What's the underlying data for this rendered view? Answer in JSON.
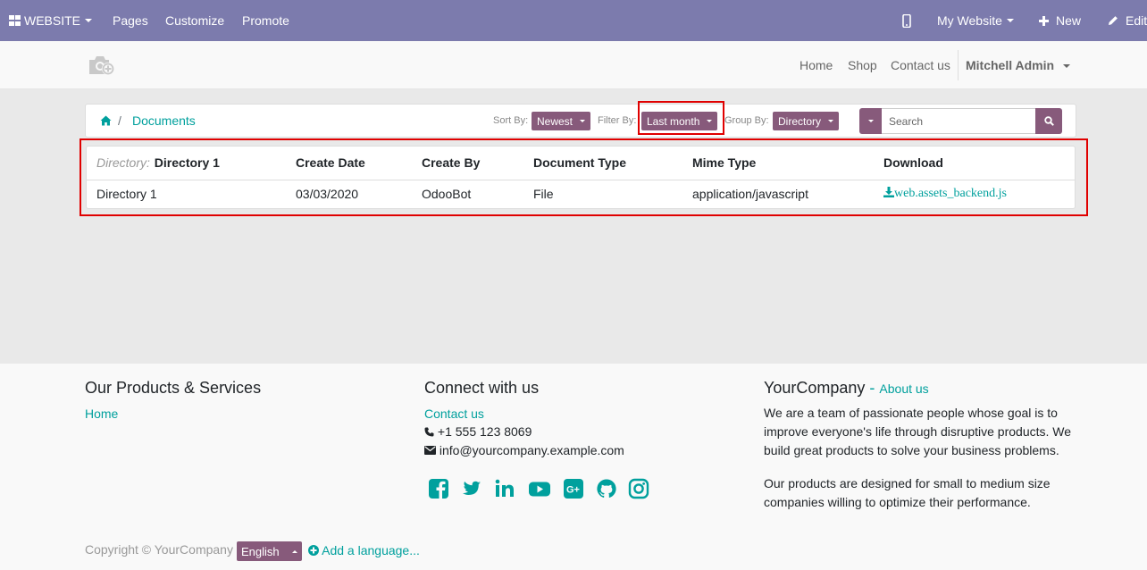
{
  "topbar": {
    "apps_label": "WEBSITE",
    "menu": [
      "Pages",
      "Customize",
      "Promote"
    ],
    "mobile_icon": "mobile-icon",
    "website_label": "My Website",
    "new_label": "New",
    "edit_label": "Edit"
  },
  "header": {
    "logo_icon": "camera-add-icon",
    "nav": [
      "Home",
      "Shop",
      "Contact us"
    ],
    "user": "Mitchell Admin"
  },
  "breadcrumb": {
    "home_icon": "home-icon",
    "separator": "/",
    "current": "Documents"
  },
  "controls": {
    "sort_label": "Sort By:",
    "sort_value": "Newest",
    "filter_label": "Filter By:",
    "filter_value": "Last month",
    "group_label": "Group By:",
    "group_value": "Directory",
    "search_placeholder": "Search"
  },
  "table": {
    "group_prefix": "Directory:",
    "group_name": "Directory 1",
    "columns": [
      "Create Date",
      "Create By",
      "Document Type",
      "Mime Type",
      "Download"
    ],
    "rows": [
      {
        "directory": "Directory 1",
        "create_date": "03/03/2020",
        "create_by": "OdooBot",
        "document_type": "File",
        "mime_type": "application/javascript",
        "download": "web.assets_backend.js"
      }
    ]
  },
  "footer": {
    "col1_title": "Our Products & Services",
    "col1_link": "Home",
    "col2_title": "Connect with us",
    "col2_link": "Contact us",
    "phone": "+1 555 123 8069",
    "email": "info@yourcompany.example.com",
    "social": [
      "facebook-icon",
      "twitter-icon",
      "linkedin-icon",
      "youtube-icon",
      "google-plus-icon",
      "github-icon",
      "instagram-icon"
    ],
    "col3_title": "YourCompany",
    "col3_title_sep": " - ",
    "col3_link": "About us",
    "about_p1": "We are a team of passionate people whose goal is to improve everyone's life through disruptive products. We build great products to solve your business problems.",
    "about_p2": "Our products are designed for small to medium size companies willing to optimize their performance.",
    "copyright": "Copyright © YourCompany",
    "language": "English",
    "add_language": "Add a language..."
  },
  "colors": {
    "topbar": "#7c7bad",
    "accent": "#875a7b",
    "link": "#00a09d",
    "highlight": "#e00000"
  }
}
